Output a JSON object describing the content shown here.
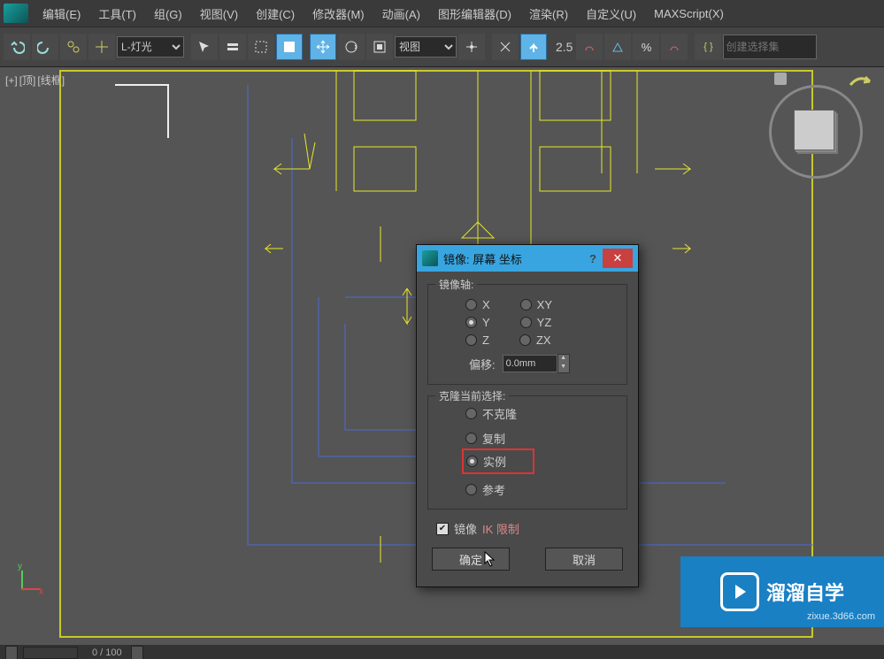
{
  "menu": {
    "edit": "编辑(E)",
    "tools": "工具(T)",
    "group": "组(G)",
    "view": "视图(V)",
    "create": "创建(C)",
    "modifier": "修改器(M)",
    "anim": "动画(A)",
    "graph": "图形编辑器(D)",
    "render": "渲染(R)",
    "custom": "自定义(U)",
    "maxscript": "MAXScript(X)"
  },
  "toolbar": {
    "sel_label": "L-灯光",
    "coord": "视图",
    "num": "2.5",
    "selset_ph": "创建选择集"
  },
  "viewport": {
    "plus": "[+]",
    "view": "[顶]",
    "mode": "[线框]"
  },
  "dialog": {
    "title": "镜像: 屏幕 坐标",
    "axis_group": "镜像轴:",
    "x": "X",
    "y": "Y",
    "z": "Z",
    "xy": "XY",
    "yz": "YZ",
    "zx": "ZX",
    "offset": "偏移:",
    "offset_val": "0.0mm",
    "clone_group": "克隆当前选择:",
    "noclone": "不克隆",
    "copy": "复制",
    "instance": "实例",
    "reference": "参考",
    "ik_chk": "镜像",
    "ik_lbl": "IK 限制",
    "ok": "确定",
    "cancel": "取消",
    "help": "?",
    "close": "✕"
  },
  "status": {
    "frame": "0 / 100"
  },
  "watermark": {
    "brand": "溜溜自学",
    "url": "zixue.3d66.com"
  },
  "axis": {
    "x": "x",
    "y": "y"
  }
}
